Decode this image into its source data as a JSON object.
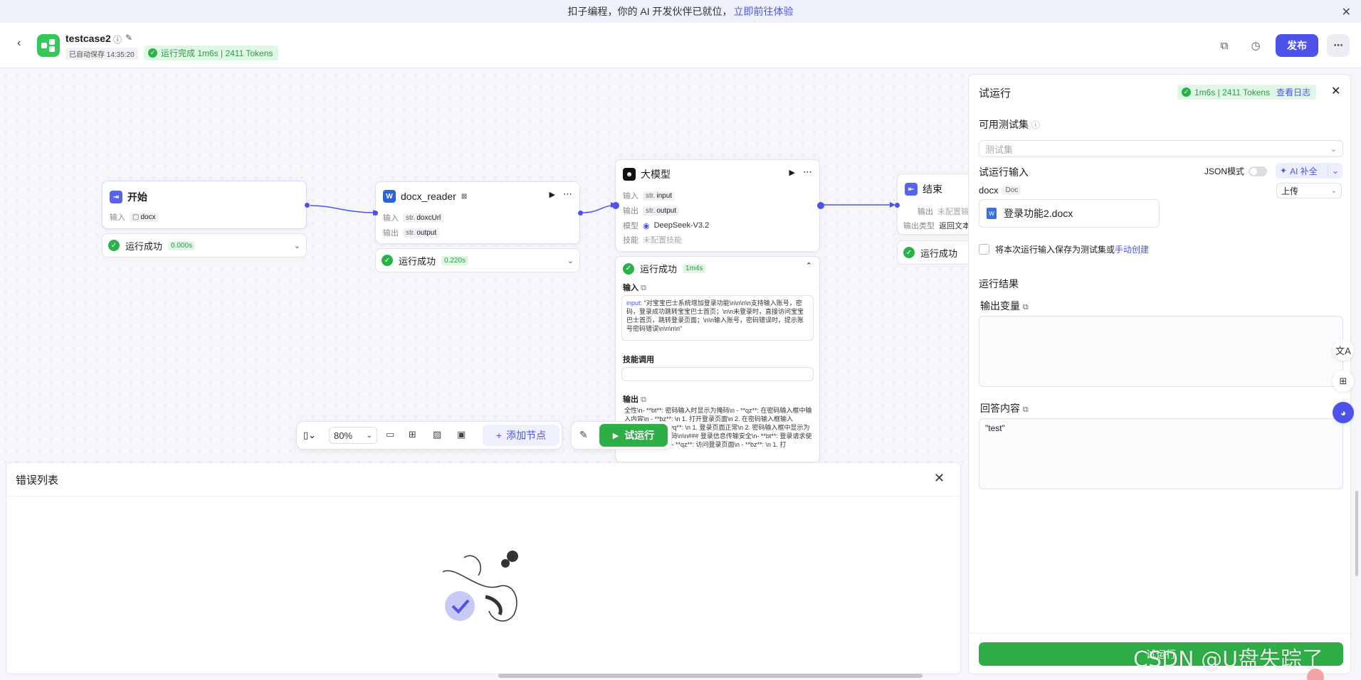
{
  "banner": {
    "text": "扣子编程，你的 AI 开发伙伴已就位，",
    "link": "立即前往体验"
  },
  "header": {
    "title": "testcase2",
    "autosave": "已自动保存 14:35:20",
    "run_status": "运行完成 1m6s | 2411 Tokens",
    "publish_label": "发布"
  },
  "nodes": {
    "start": {
      "title": "开始",
      "input_label": "输入",
      "input_value": "docx",
      "status": "运行成功",
      "time": "0.000s"
    },
    "docx_reader": {
      "title": "docx_reader",
      "in_label": "输入",
      "in_type": "str.",
      "in_value": "doxcUrl",
      "out_label": "输出",
      "out_type": "str.",
      "out_value": "output",
      "status": "运行成功",
      "time": "0.220s"
    },
    "llm": {
      "title": "大模型",
      "in_label": "输入",
      "in_type": "str.",
      "in_value": "input",
      "out_label": "输出",
      "out_type": "str.",
      "out_value": "output",
      "model_label": "模型",
      "model_value": "DeepSeek-V3.2",
      "skill_label": "技能",
      "skill_value": "未配置技能",
      "status": "运行成功",
      "time": "1m4s",
      "input_section": "输入",
      "input_key": "input",
      "input_text": "\"对宝宝巴士系统增加登录功能\\n\\n\\n\\n支持输入账号，密码，登录成功跳转宝宝巴士首页；\\n\\n未登录时，直接访问宝宝巴士首页，跳转登录页面；\\n\\n输入账号，密码错误时，提示账号密码错误\\n\\n\\n\\n\"",
      "skills_section": "技能调用",
      "output_section": "输出",
      "output_text": "全性\\n- **bt**: 密码输入时显示为掩码\\n - **qz**: 在密码输入框中输入内容\\n - **bz**: \\n  1. 打开登录页面\\n  2. 在密码输入框输入\\\"123456\\\"\\n - **yq**: \\n  1. 登录页面正常\\n  2. 密码输入框中显示为\\\"······\\\"或类似掩码\\n\\n### 登录信息传输安全\\n- **bt**: 登录请求使用HTTPS传输\\n - **qz**: 访问登录页面\\n - **bz**: \\n  1. 打"
    },
    "end": {
      "title": "结束",
      "out_label": "输出",
      "out_value": "未配置输",
      "type_label": "输出类型",
      "type_value": "返回文本",
      "status": "运行成功"
    }
  },
  "toolbar": {
    "zoom": "80%",
    "add_node": "添加节点",
    "run": "试运行"
  },
  "error_panel": {
    "title": "错误列表"
  },
  "test_panel": {
    "title": "试运行",
    "run_info": "1m6s | 2411 Tokens",
    "view_log": "查看日志",
    "testset_label": "可用测试集",
    "testset_placeholder": "测试集",
    "input_label": "试运行输入",
    "json_mode": "JSON模式",
    "ai_fill": "AI 补全",
    "docx_label": "docx",
    "docx_type": "Doc",
    "upload": "上传",
    "file_name": "登录功能2.docx",
    "save_prefix": "将本次运行输入保存为测试集或",
    "save_link": "手动创建",
    "result_label": "运行结果",
    "output_var": "输出变量",
    "answer_label": "回答内容",
    "answer_value": "\"test\"",
    "footer_run": "试运行"
  },
  "watermark": "CSDN @U盘失踪了"
}
